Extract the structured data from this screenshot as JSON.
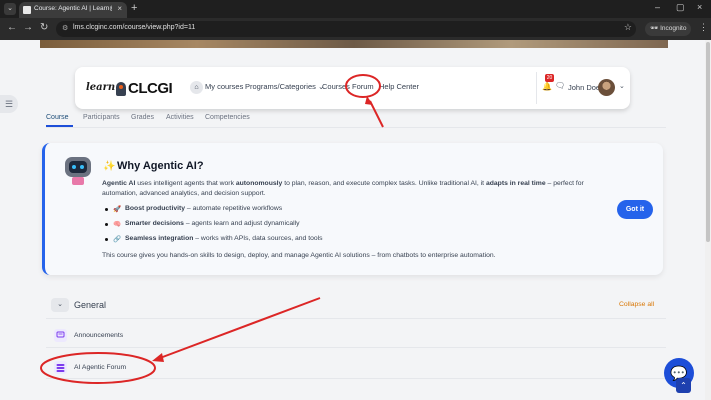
{
  "browser": {
    "tab_title": "Course: Agentic AI | Learn@CLC...",
    "url": "lms.clcginc.com/course/view.php?id=11",
    "incognito_label": "Incognito"
  },
  "site": {
    "logo_learn": "learn",
    "logo_brand": "CLCGI",
    "nav": [
      "My courses",
      "Programs/Categories ⌄",
      "Courses",
      "Forum",
      "Help Center"
    ],
    "notification_count": "20",
    "user_name": "John Doe"
  },
  "course_tabs": [
    "Course",
    "Participants",
    "Grades",
    "Activities",
    "Competencies"
  ],
  "info": {
    "title": "Why Agentic AI?",
    "para_bold1": "Agentic AI",
    "para_1": " uses intelligent agents that work ",
    "para_bold2": "autonomously",
    "para_2": " to plan, reason, and execute complex tasks. Unlike traditional AI, it ",
    "para_bold3": "adapts in real time",
    "para_3": " – perfect for automation, advanced analytics, and decision support.",
    "bullets": [
      {
        "icon": "rocket-icon",
        "bold": "Boost productivity",
        "text": " – automate repetitive workflows"
      },
      {
        "icon": "brain-icon",
        "bold": "Smarter decisions",
        "text": " – agents learn and adjust dynamically"
      },
      {
        "icon": "link-icon",
        "bold": "Seamless integration",
        "text": " – works with APIs, data sources, and tools"
      }
    ],
    "footer": "This course gives you hands-on skills to design, deploy, and manage Agentic AI solutions – from chatbots to enterprise automation.",
    "button": "Got it"
  },
  "section": {
    "title": "General",
    "collapse_all": "Collapse all",
    "activities": [
      {
        "label": "Announcements",
        "icon": "forum-icon",
        "color": "#7c3aed"
      },
      {
        "label": "AI Agentic Forum",
        "icon": "forum-icon",
        "color": "#7c3aed"
      }
    ]
  },
  "colors": {
    "accent": "#2563eb",
    "annotation": "#dc2626",
    "collapse_all": "#d97706"
  }
}
